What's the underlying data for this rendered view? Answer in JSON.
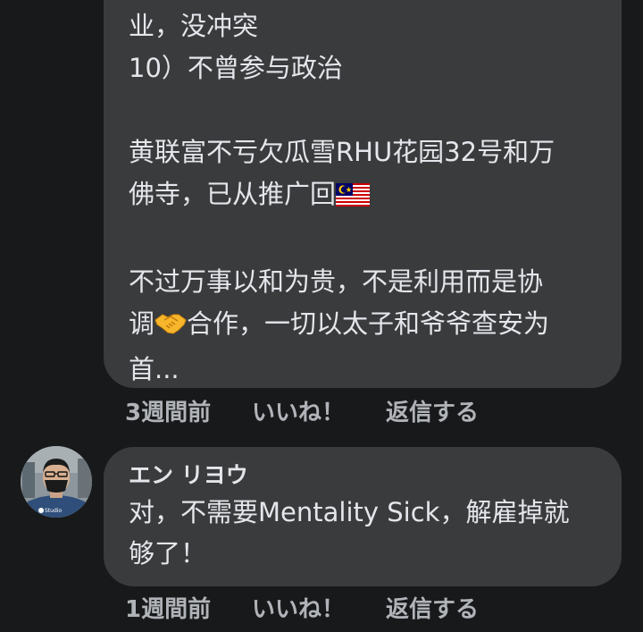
{
  "comment1": {
    "lines": [
      "业，没冲突",
      "10）不曾参与政治",
      "",
      "黄联富不亏欠瓜雪RHU花园32号和万",
      "佛寺，已从推广回",
      "",
      "不过万事以和为贵，不是利用而是协",
      "调",
      "合作，一切以太子和爷爷查安为",
      "首..."
    ],
    "flag_emoji": "malaysia-flag",
    "handshake_emoji": "handshake",
    "actions": {
      "time": "3週間前",
      "like": "いいね！",
      "reply": "返信する"
    }
  },
  "comment2": {
    "author": "エン リヨウ",
    "lines": [
      "对，不需要Mentality Sick，解雇掉就",
      "够了！"
    ],
    "avatar_badge": "Studio",
    "actions": {
      "time": "1週間前",
      "like": "いいね！",
      "reply": "返信する"
    }
  }
}
